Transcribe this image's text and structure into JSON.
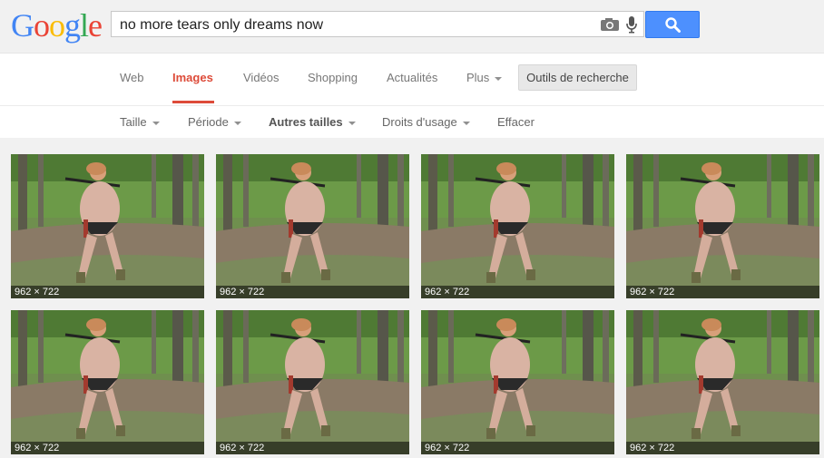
{
  "logo": {
    "text": "Google",
    "colors": [
      "#4285f4",
      "#ea4335",
      "#fbbc05",
      "#4285f4",
      "#34a853",
      "#ea4335"
    ]
  },
  "search": {
    "query": "no more tears only dreams now"
  },
  "tabs": [
    {
      "label": "Web",
      "active": false
    },
    {
      "label": "Images",
      "active": true
    },
    {
      "label": "Vidéos",
      "active": false
    },
    {
      "label": "Shopping",
      "active": false
    },
    {
      "label": "Actualités",
      "active": false
    },
    {
      "label": "Plus",
      "active": false
    }
  ],
  "tools_button": "Outils de recherche",
  "toolbar": {
    "taille": "Taille",
    "periode": "Période",
    "autres_tailles": "Autres tailles",
    "droits": "Droits d'usage",
    "effacer": "Effacer"
  },
  "results": [
    {
      "dims": "962 × 722"
    },
    {
      "dims": "962 × 722"
    },
    {
      "dims": "962 × 722"
    },
    {
      "dims": "962 × 722"
    },
    {
      "dims": "962 × 722"
    },
    {
      "dims": "962 × 722"
    },
    {
      "dims": "962 × 722"
    },
    {
      "dims": "962 × 722"
    }
  ],
  "colors": {
    "accent": "#dd4b39",
    "button": "#4d90fe"
  }
}
